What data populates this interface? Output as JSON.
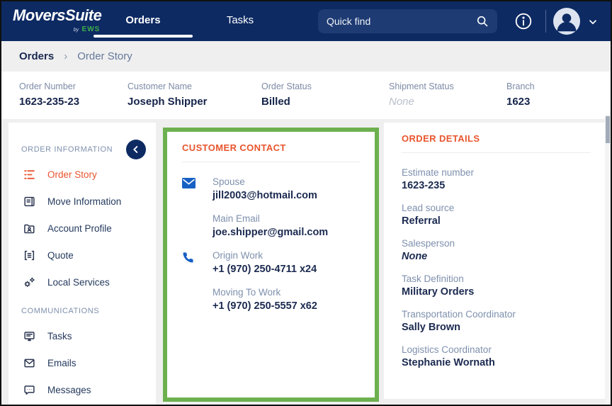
{
  "header": {
    "logo": {
      "title": "MoversSuite",
      "by": "by",
      "brand": "EWS"
    },
    "tabs": [
      {
        "label": "Orders",
        "active": true
      },
      {
        "label": "Tasks",
        "active": false
      }
    ],
    "search": {
      "placeholder": "Quick find"
    }
  },
  "breadcrumb": {
    "items": [
      "Orders",
      "Order Story"
    ],
    "separator": "›"
  },
  "order_summary": {
    "fields": [
      {
        "label": "Order Number",
        "value": "1623-235-23"
      },
      {
        "label": "Customer Name",
        "value": "Joseph Shipper"
      },
      {
        "label": "Order Status",
        "value": "Billed"
      },
      {
        "label": "Shipment Status",
        "value": "None"
      },
      {
        "label": "Branch",
        "value": "1623"
      }
    ]
  },
  "sidebar": {
    "sections": [
      {
        "title": "ORDER INFORMATION",
        "items": [
          {
            "label": "Order Story",
            "icon": "order-story-icon",
            "active": true
          },
          {
            "label": "Move Information",
            "icon": "move-information-icon",
            "active": false
          },
          {
            "label": "Account Profile",
            "icon": "account-profile-icon",
            "active": false
          },
          {
            "label": "Quote",
            "icon": "quote-icon",
            "active": false
          },
          {
            "label": "Local Services",
            "icon": "local-services-icon",
            "active": false
          }
        ]
      },
      {
        "title": "COMMUNICATIONS",
        "items": [
          {
            "label": "Tasks",
            "icon": "tasks-icon",
            "active": false
          },
          {
            "label": "Emails",
            "icon": "emails-icon",
            "active": false
          },
          {
            "label": "Messages",
            "icon": "messages-icon",
            "active": false
          }
        ]
      }
    ]
  },
  "customer_contact": {
    "title": "CUSTOMER CONTACT",
    "entries": [
      {
        "icon": "email-icon",
        "label": "Spouse",
        "value": "jill2003@hotmail.com"
      },
      {
        "icon": "",
        "label": "Main Email",
        "value": "joe.shipper@gmail.com"
      },
      {
        "icon": "phone-icon",
        "label": "Origin Work",
        "value": "+1 (970) 250-4711 x24"
      },
      {
        "icon": "",
        "label": "Moving To Work",
        "value": "+1 (970) 250-5557 x62"
      }
    ]
  },
  "order_details": {
    "title": "ORDER DETAILS",
    "fields": [
      {
        "label": "Estimate number",
        "value": "1623-235",
        "muted": false
      },
      {
        "label": "Lead source",
        "value": "Referral",
        "muted": false
      },
      {
        "label": "Salesperson",
        "value": "None",
        "muted": true
      },
      {
        "label": "Task Definition",
        "value": "Military Orders",
        "muted": false
      },
      {
        "label": "Transportation Coordinator",
        "value": "Sally Brown",
        "muted": false
      },
      {
        "label": "Logistics Coordinator",
        "value": "Stephanie Wornath",
        "muted": false
      }
    ]
  },
  "colors": {
    "nav_background": "#0d2a63",
    "accent_orange": "#e8552e",
    "highlight_green": "#6db04f",
    "contact_icon_blue": "#1760c4",
    "brand_green": "#3fae49"
  }
}
